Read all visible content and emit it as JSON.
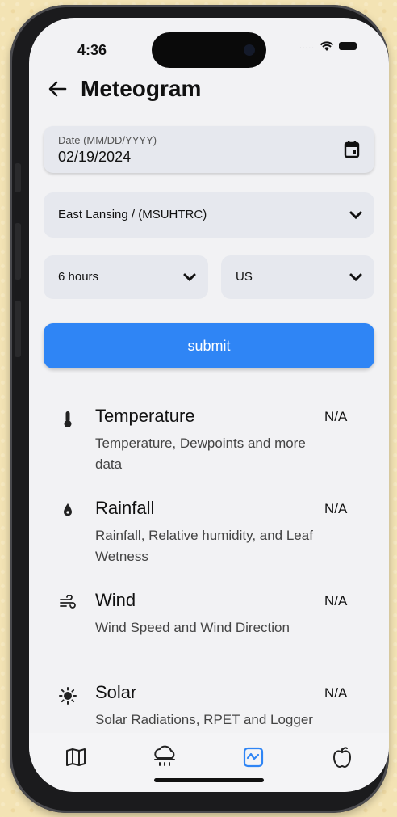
{
  "status_bar": {
    "time": "4:36",
    "signal_dots": "....."
  },
  "header": {
    "title": "Meteogram"
  },
  "form": {
    "date_label": "Date (MM/DD/YYYY)",
    "date_value": "02/19/2024",
    "location": "East Lansing / (MSUHTRC)",
    "duration": "6 hours",
    "units": "US",
    "submit_label": "submit"
  },
  "items": [
    {
      "icon": "thermometer-icon",
      "name": "Temperature",
      "desc": "Temperature, Dewpoints and more data",
      "value": "N/A"
    },
    {
      "icon": "raindrop-icon",
      "name": "Rainfall",
      "desc": "Rainfall, Relative humidity, and Leaf Wetness",
      "value": "N/A"
    },
    {
      "icon": "wind-icon",
      "name": "Wind",
      "desc": "Wind Speed and Wind Direction",
      "value": "N/A"
    },
    {
      "icon": "sun-icon",
      "name": "Solar",
      "desc": "Solar Radiations, RPET and Logger Voltages",
      "value": "N/A"
    }
  ],
  "nav": [
    {
      "icon": "map-icon",
      "active": false
    },
    {
      "icon": "rain-cloud-icon",
      "active": false
    },
    {
      "icon": "chart-icon",
      "active": true
    },
    {
      "icon": "apple-icon",
      "active": false
    }
  ],
  "colors": {
    "accent": "#2f85f5",
    "background": "#f2f2f4",
    "field": "#e6e8ee"
  }
}
